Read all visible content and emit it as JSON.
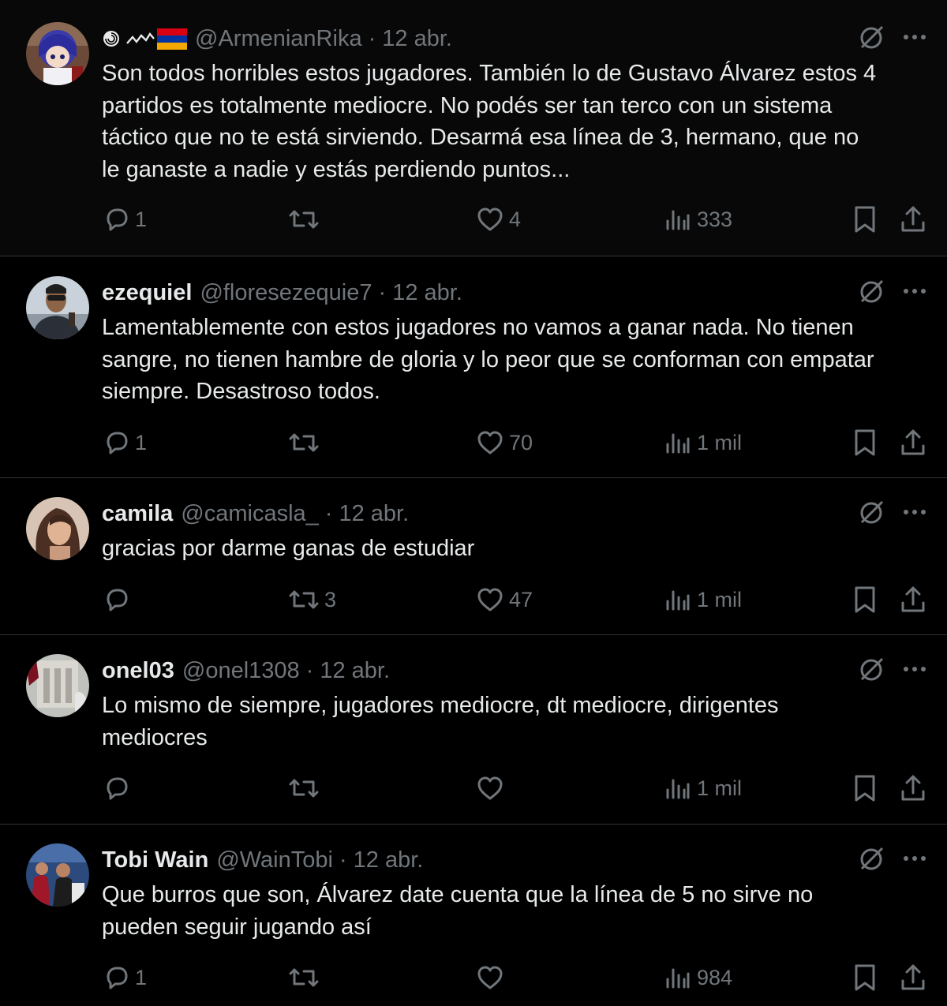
{
  "colors": {
    "background": "#000000",
    "text_primary": "#e7e9ea",
    "text_secondary": "#71767b",
    "divider": "#2f3336"
  },
  "icons": {
    "reply": "reply-icon",
    "retweet": "retweet-icon",
    "like": "heart-icon",
    "views": "views-icon",
    "bookmark": "bookmark-icon",
    "share": "share-icon",
    "grok": "grok-icon",
    "more": "more-icon"
  },
  "tweets": [
    {
      "display_name": "",
      "name_badges": [
        "spiral-icon",
        "wave-icon",
        "armenian-flag-icon"
      ],
      "handle": "@ArmenianRika",
      "separator": "·",
      "time": "12 abr.",
      "text": "Son todos horribles estos jugadores. También lo de Gustavo Álvarez estos 4\npartidos es totalmente mediocre. No podés ser tan terco con un sistema\ntáctico que no te está sirviendo. Desarmá esa línea de 3, hermano, que no\nle ganaste a nadie y estás perdiendo puntos...",
      "replies": "1",
      "retweets": "",
      "likes": "4",
      "views": "333"
    },
    {
      "display_name": "ezequiel",
      "handle": "@floresezequie7",
      "separator": "·",
      "time": "12 abr.",
      "text": "Lamentablemente con estos jugadores no vamos a ganar nada. No tienen\nsangre, no tienen hambre de gloria y lo peor que se conforman con empatar\nsiempre. Desastroso todos.",
      "replies": "1",
      "retweets": "",
      "likes": "70",
      "views": "1 mil"
    },
    {
      "display_name": "camila",
      "handle": "@camicasla_",
      "separator": "·",
      "time": "12 abr.",
      "text": "gracias por darme ganas de estudiar",
      "replies": "",
      "retweets": "3",
      "likes": "47",
      "views": "1 mil"
    },
    {
      "display_name": "onel03",
      "handle": "@onel1308",
      "separator": "·",
      "time": "12 abr.",
      "text": "Lo mismo de siempre, jugadores mediocre, dt mediocre, dirigentes\nmediocres",
      "replies": "",
      "retweets": "",
      "likes": "",
      "views": "1 mil"
    },
    {
      "display_name": "Tobi Wain",
      "handle": "@WainTobi",
      "separator": "·",
      "time": "12 abr.",
      "text": "Que burros que son, Álvarez date cuenta que la línea de 5 no sirve no\npueden seguir jugando así",
      "replies": "1",
      "retweets": "",
      "likes": "",
      "views": "984"
    }
  ]
}
